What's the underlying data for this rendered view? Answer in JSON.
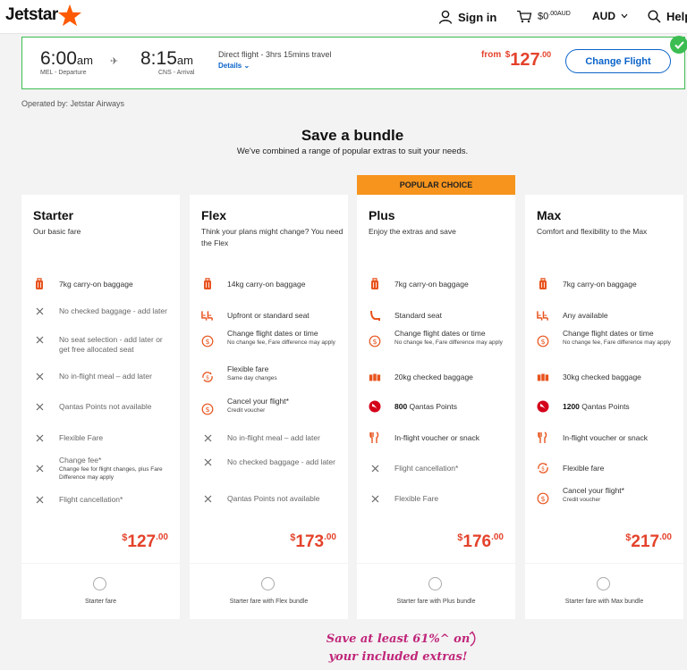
{
  "header": {
    "logo": "Jetstar",
    "signin": "Sign in",
    "cart_amount": "$0",
    "cart_sup": ".00AUD",
    "currency": "AUD",
    "help": "Help",
    "brand_color": "#ff5a00"
  },
  "flight": {
    "dep_time": "6:00",
    "dep_ampm": "am",
    "dep_label": "MEL - Departure",
    "arr_time": "8:15",
    "arr_ampm": "am",
    "arr_label": "CNS - Arrival",
    "direct": "Direct flight - 3hrs 15mins travel",
    "details": "Details",
    "price_from": "from",
    "price_cur": "$",
    "price_amt": "127",
    "price_cents": ".00",
    "change_btn": "Change Flight"
  },
  "operated": "Operated by:  Jetstar Airways",
  "bundle": {
    "title": "Save a bundle",
    "subtitle": "We've combined a range of popular extras to suit your needs.",
    "popular": "POPULAR CHOICE"
  },
  "cards": [
    {
      "name": "Starter",
      "desc": "Our basic fare",
      "price_cur": "$",
      "price_amt": "127",
      "price_cents": ".00",
      "select_label": "Starter fare",
      "features": [
        {
          "icon": "baggage-icon",
          "text": "7kg carry-on baggage",
          "note": "",
          "included": true
        },
        {
          "icon": "cross-icon",
          "text": "No checked baggage - add later",
          "note": "",
          "included": false
        },
        {
          "icon": "cross-icon",
          "text": "No seat selection - add later or get free allocated seat",
          "note": "",
          "included": false
        },
        {
          "icon": "cross-icon",
          "text": "No in-flight meal – add later",
          "note": "",
          "included": false
        },
        {
          "icon": "cross-icon",
          "text": "Qantas Points not available",
          "note": "",
          "included": false
        },
        {
          "icon": "cross-icon",
          "text": "Flexible Fare",
          "note": "",
          "included": false
        },
        {
          "icon": "cross-icon",
          "text": "Change fee*",
          "note": "Change fee for flight changes, plus Fare Difference may apply",
          "included": false
        },
        {
          "icon": "cross-icon",
          "text": "Flight cancellation*",
          "note": "",
          "included": false
        }
      ]
    },
    {
      "name": "Flex",
      "desc": "Think your plans might change? You need the Flex",
      "price_cur": "$",
      "price_amt": "173",
      "price_cents": ".00",
      "select_label": "Starter fare with Flex bundle",
      "features": [
        {
          "icon": "baggage-icon",
          "text": "14kg carry-on baggage",
          "note": "",
          "included": true
        },
        {
          "icon": "seats-icon",
          "text": "Upfront or standard seat",
          "note": "",
          "included": true
        },
        {
          "icon": "dollar-icon",
          "text": "Change flight dates or time",
          "note": "No change fee, Fare difference may apply",
          "included": true
        },
        {
          "icon": "flex-icon",
          "text": "Flexible fare",
          "note": "Same day changes",
          "included": true
        },
        {
          "icon": "dollar-icon",
          "text": "Cancel your flight*",
          "note": "Credit voucher",
          "included": true
        },
        {
          "icon": "cross-icon",
          "text": "No in-flight meal – add later",
          "note": "",
          "included": false
        },
        {
          "icon": "cross-icon",
          "text": "No checked baggage - add later",
          "note": "",
          "included": false
        },
        {
          "icon": "cross-icon",
          "text": "Qantas Points not available",
          "note": "",
          "included": false
        }
      ]
    },
    {
      "name": "Plus",
      "desc": "Enjoy the extras and save",
      "price_cur": "$",
      "price_amt": "176",
      "price_cents": ".00",
      "select_label": "Starter fare with Plus bundle",
      "features": [
        {
          "icon": "baggage-icon",
          "text": "7kg carry-on baggage",
          "note": "",
          "included": true
        },
        {
          "icon": "seat-icon",
          "text": "Standard seat",
          "note": "",
          "included": true
        },
        {
          "icon": "dollar-icon",
          "text": "Change flight dates or time",
          "note": "No change fee, Fare difference may apply",
          "included": true
        },
        {
          "icon": "checked-bag-icon",
          "text": "20kg checked baggage",
          "note": "",
          "included": true
        },
        {
          "icon": "qantas-icon",
          "text_bold": "800",
          "text": " Qantas Points",
          "note": "",
          "included": true
        },
        {
          "icon": "meal-icon",
          "text": "In-flight voucher or snack",
          "note": "",
          "included": true
        },
        {
          "icon": "cross-icon",
          "text": "Flight cancellation*",
          "note": "",
          "included": false
        },
        {
          "icon": "cross-icon",
          "text": "Flexible Fare",
          "note": "",
          "included": false
        }
      ]
    },
    {
      "name": "Max",
      "desc": "Comfort and flexibility to the Max",
      "price_cur": "$",
      "price_amt": "217",
      "price_cents": ".00",
      "select_label": "Starter fare with Max bundle",
      "features": [
        {
          "icon": "baggage-icon",
          "text": "7kg carry-on baggage",
          "note": "",
          "included": true
        },
        {
          "icon": "seats-icon",
          "text": "Any available",
          "note": "",
          "included": true
        },
        {
          "icon": "dollar-icon",
          "text": "Change flight dates or time",
          "note": "No change fee, Fare difference may apply",
          "included": true
        },
        {
          "icon": "checked-bag-icon",
          "text": "30kg checked baggage",
          "note": "",
          "included": true
        },
        {
          "icon": "qantas-icon",
          "text_bold": "1200",
          "text": " Qantas Points",
          "note": "",
          "included": true
        },
        {
          "icon": "meal-icon",
          "text": "In-flight voucher or snack",
          "note": "",
          "included": true
        },
        {
          "icon": "flex-icon",
          "text": "Flexible fare",
          "note": "",
          "included": true
        },
        {
          "icon": "dollar-icon",
          "text": "Cancel your flight*",
          "note": "Credit voucher",
          "included": true
        }
      ]
    }
  ],
  "promo": {
    "line1": "Save at least 61%^ on",
    "line2": "your included extras!"
  },
  "colors": {
    "price": "#e4422b",
    "link": "#0a63c9",
    "popular": "#f7941d",
    "success": "#3cbd52",
    "promo": "#c0267a"
  }
}
